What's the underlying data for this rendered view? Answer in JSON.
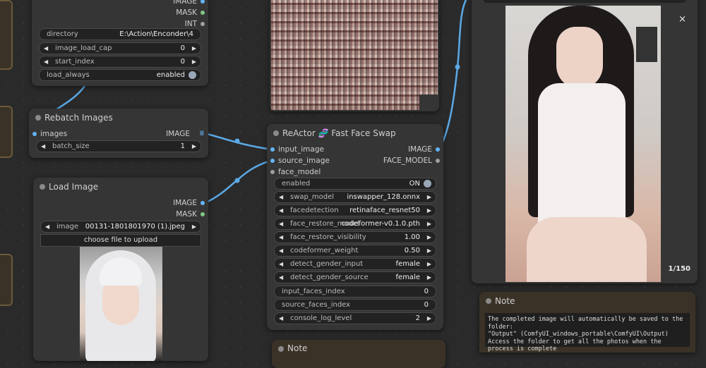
{
  "colors": {
    "link": "#5aa9e6",
    "image_port": "#64b5f6",
    "mask_port": "#81c784",
    "int_port": "#a0a0a0",
    "note_bg": "#3a3226"
  },
  "load_images_node": {
    "outputs": [
      "IMAGE",
      "MASK",
      "INT"
    ],
    "directory": {
      "label": "directory",
      "value": "E:\\Action\\Enconder\\4"
    },
    "image_load_cap": {
      "label": "image_load_cap",
      "value": "0"
    },
    "start_index": {
      "label": "start_index",
      "value": "0"
    },
    "load_always": {
      "label": "load_always",
      "value": "enabled"
    }
  },
  "rebatch_node": {
    "title": "Rebatch Images",
    "input": "images",
    "output": "IMAGE",
    "output_marker": "Ⅲ",
    "batch_size": {
      "label": "batch_size",
      "value": "1"
    }
  },
  "load_image_node": {
    "title": "Load Image",
    "outputs": [
      "IMAGE",
      "MASK"
    ],
    "image": {
      "label": "image",
      "value": "00131-1801801970 (1).jpeg"
    },
    "upload_label": "choose file to upload"
  },
  "reactor_node": {
    "title": "ReActor 🧬 Fast Face Swap",
    "inputs": [
      "input_image",
      "source_image",
      "face_model"
    ],
    "outputs": [
      "IMAGE",
      "FACE_MODEL"
    ],
    "enabled": {
      "label": "enabled",
      "value": "ON"
    },
    "swap_model": {
      "label": "swap_model",
      "value": "inswapper_128.onnx"
    },
    "facedetection": {
      "label": "facedetection",
      "value": "retinaface_resnet50"
    },
    "face_restore_model": {
      "label": "face_restore_model",
      "value": "codeformer-v0.1.0.pth"
    },
    "face_restore_visibility": {
      "label": "face_restore_visibility",
      "value": "1.00"
    },
    "codeformer_weight": {
      "label": "codeformer_weight",
      "value": "0.50"
    },
    "detect_gender_input": {
      "label": "detect_gender_input",
      "value": "female"
    },
    "detect_gender_source": {
      "label": "detect_gender_source",
      "value": "female"
    },
    "input_faces_index": {
      "label": "input_faces_index",
      "value": "0"
    },
    "source_faces_index": {
      "label": "source_faces_index",
      "value": "0"
    },
    "console_log_level": {
      "label": "console_log_level",
      "value": "2"
    }
  },
  "preview_node": {
    "close_label": "×",
    "counter": "1/150"
  },
  "note_right": {
    "title": "Note",
    "text": "The completed image will automatically be saved to the folder:\n\"Output\" (ComfyUI_windows_portable\\ComfyUI\\Output)\nAccess the folder to get all the photos when the process is complete"
  },
  "note_bottom": {
    "title": "Note"
  }
}
